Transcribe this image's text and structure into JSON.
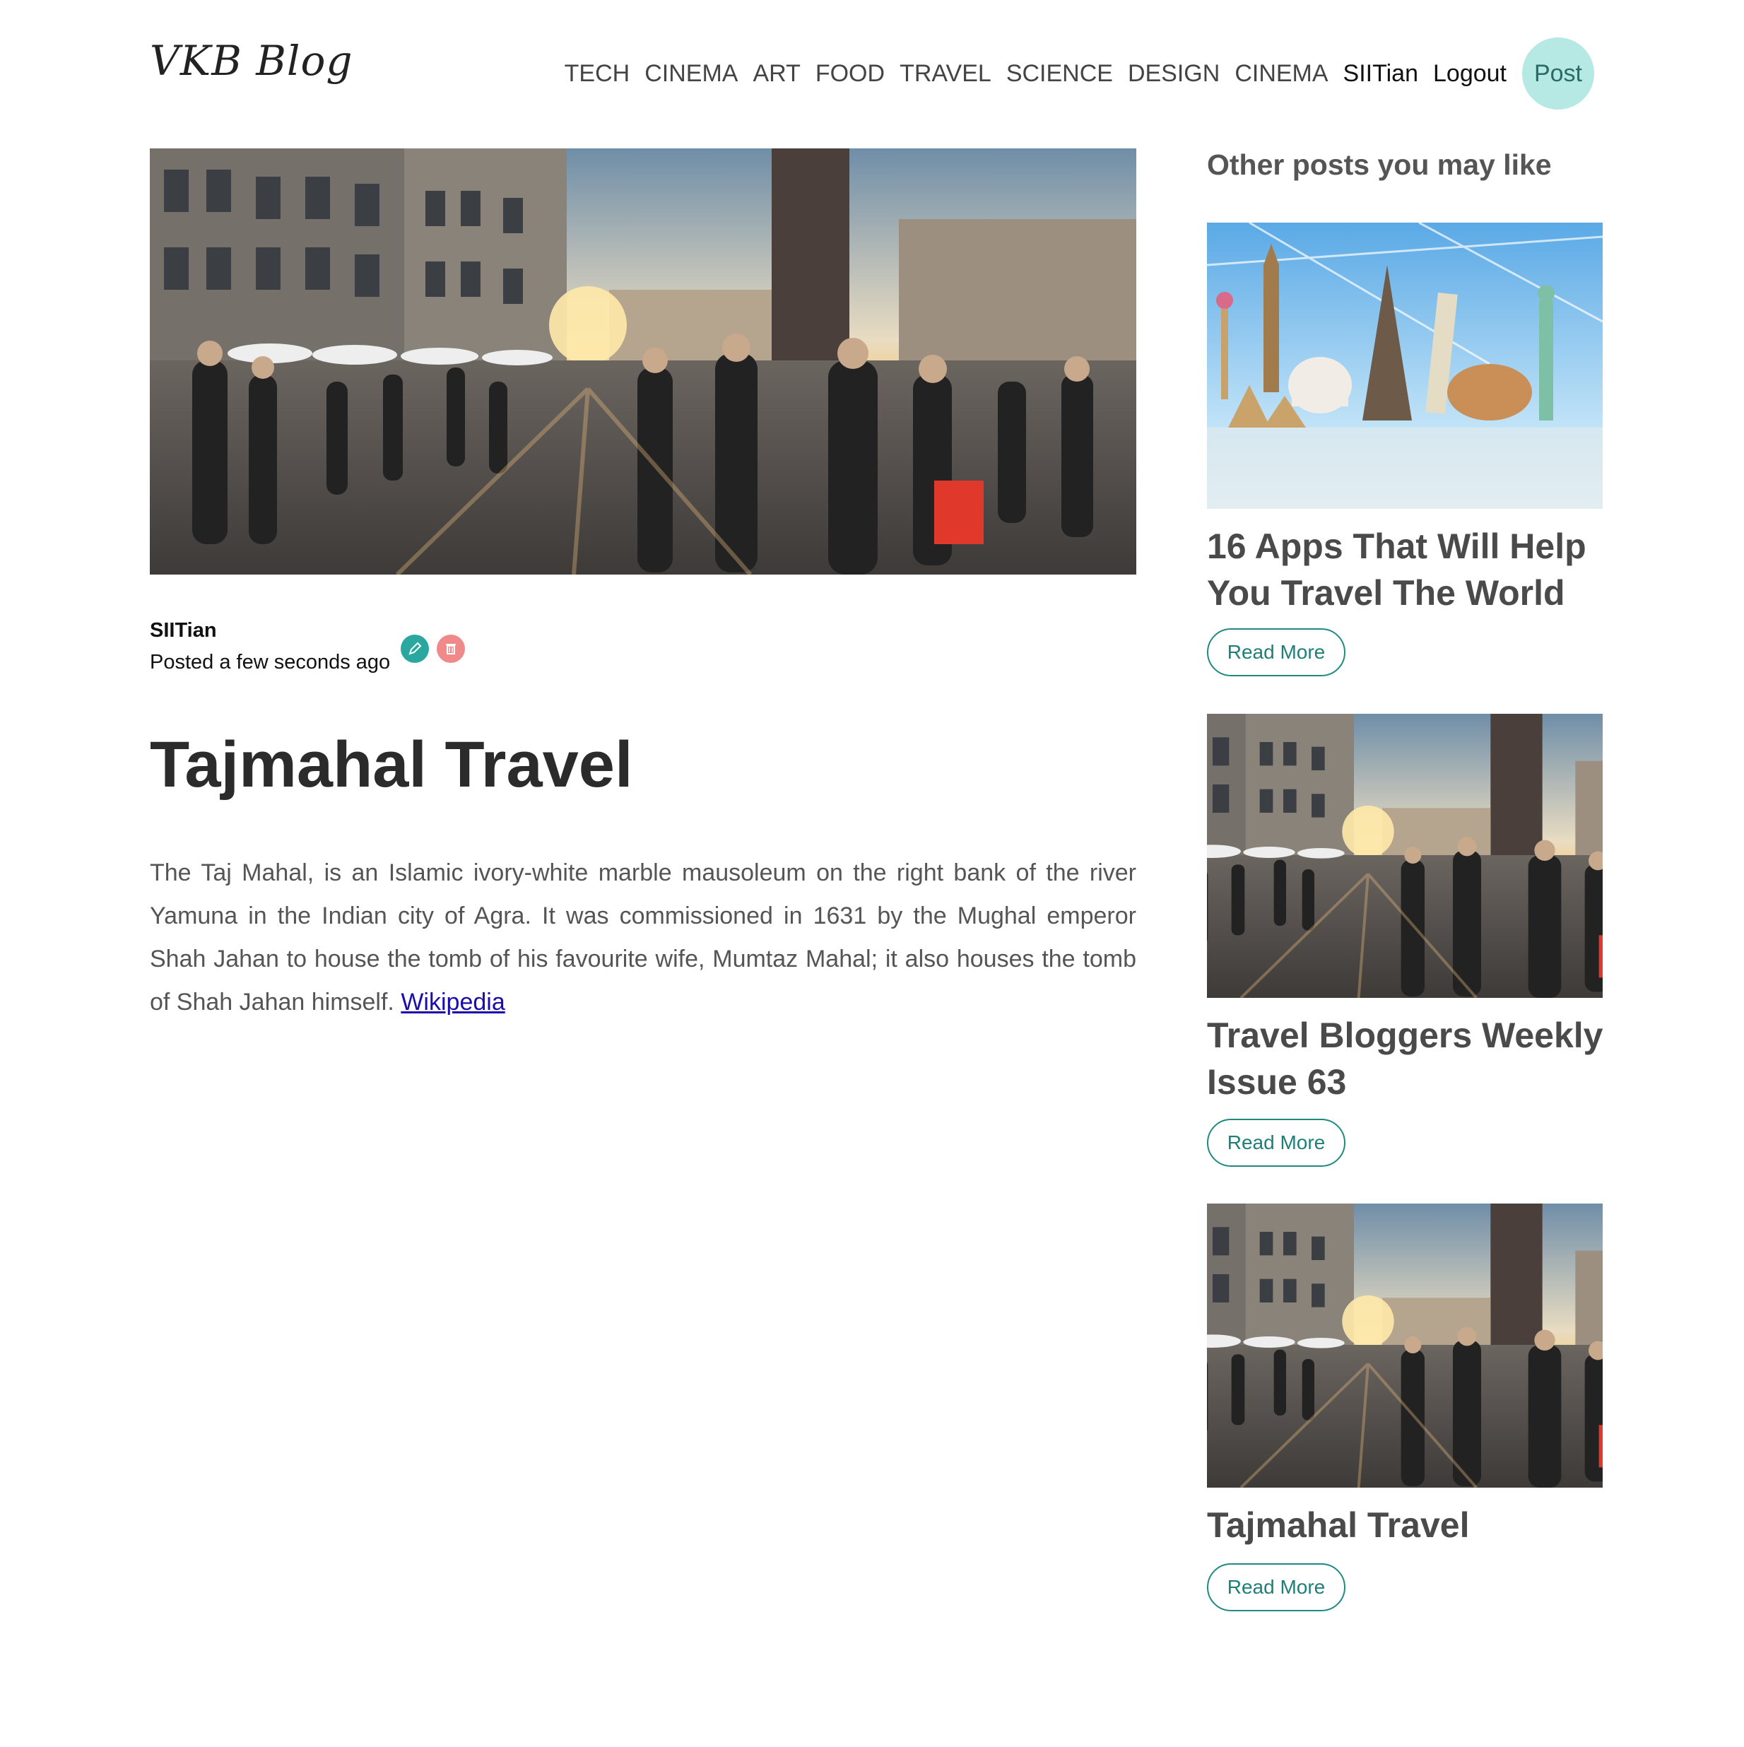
{
  "header": {
    "logo": "VKB Blog",
    "nav": [
      "TECH",
      "CINEMA",
      "ART",
      "FOOD",
      "TRAVEL",
      "SCIENCE",
      "DESIGN",
      "CINEMA"
    ],
    "user": "SIITian",
    "logout": "Logout",
    "post_button": "Post"
  },
  "post": {
    "author": "SIITian",
    "posted": "Posted a few seconds ago",
    "title": "Tajmahal Travel",
    "body": "The Taj Mahal, is an Islamic ivory-white marble mausoleum on the right bank of the river Yamuna in the Indian city of Agra. It was commissioned in 1631 by the Mughal emperor Shah Jahan to house the tomb of his favourite wife, Mumtaz Mahal; it also houses the tomb of Shah Jahan himself.",
    "link_text": "Wikipedia"
  },
  "sidebar": {
    "heading": "Other posts you may like",
    "posts": [
      {
        "title": "16 Apps That Will Help You Travel The World",
        "button": "Read More"
      },
      {
        "title": "Travel Bloggers Weekly Issue 63",
        "button": "Read More"
      },
      {
        "title": "Tajmahal Travel",
        "button": "Read More"
      }
    ]
  },
  "colors": {
    "accent": "#2aa8a0",
    "post_button_bg": "#b6e8e4",
    "delete": "#f08a8a"
  }
}
